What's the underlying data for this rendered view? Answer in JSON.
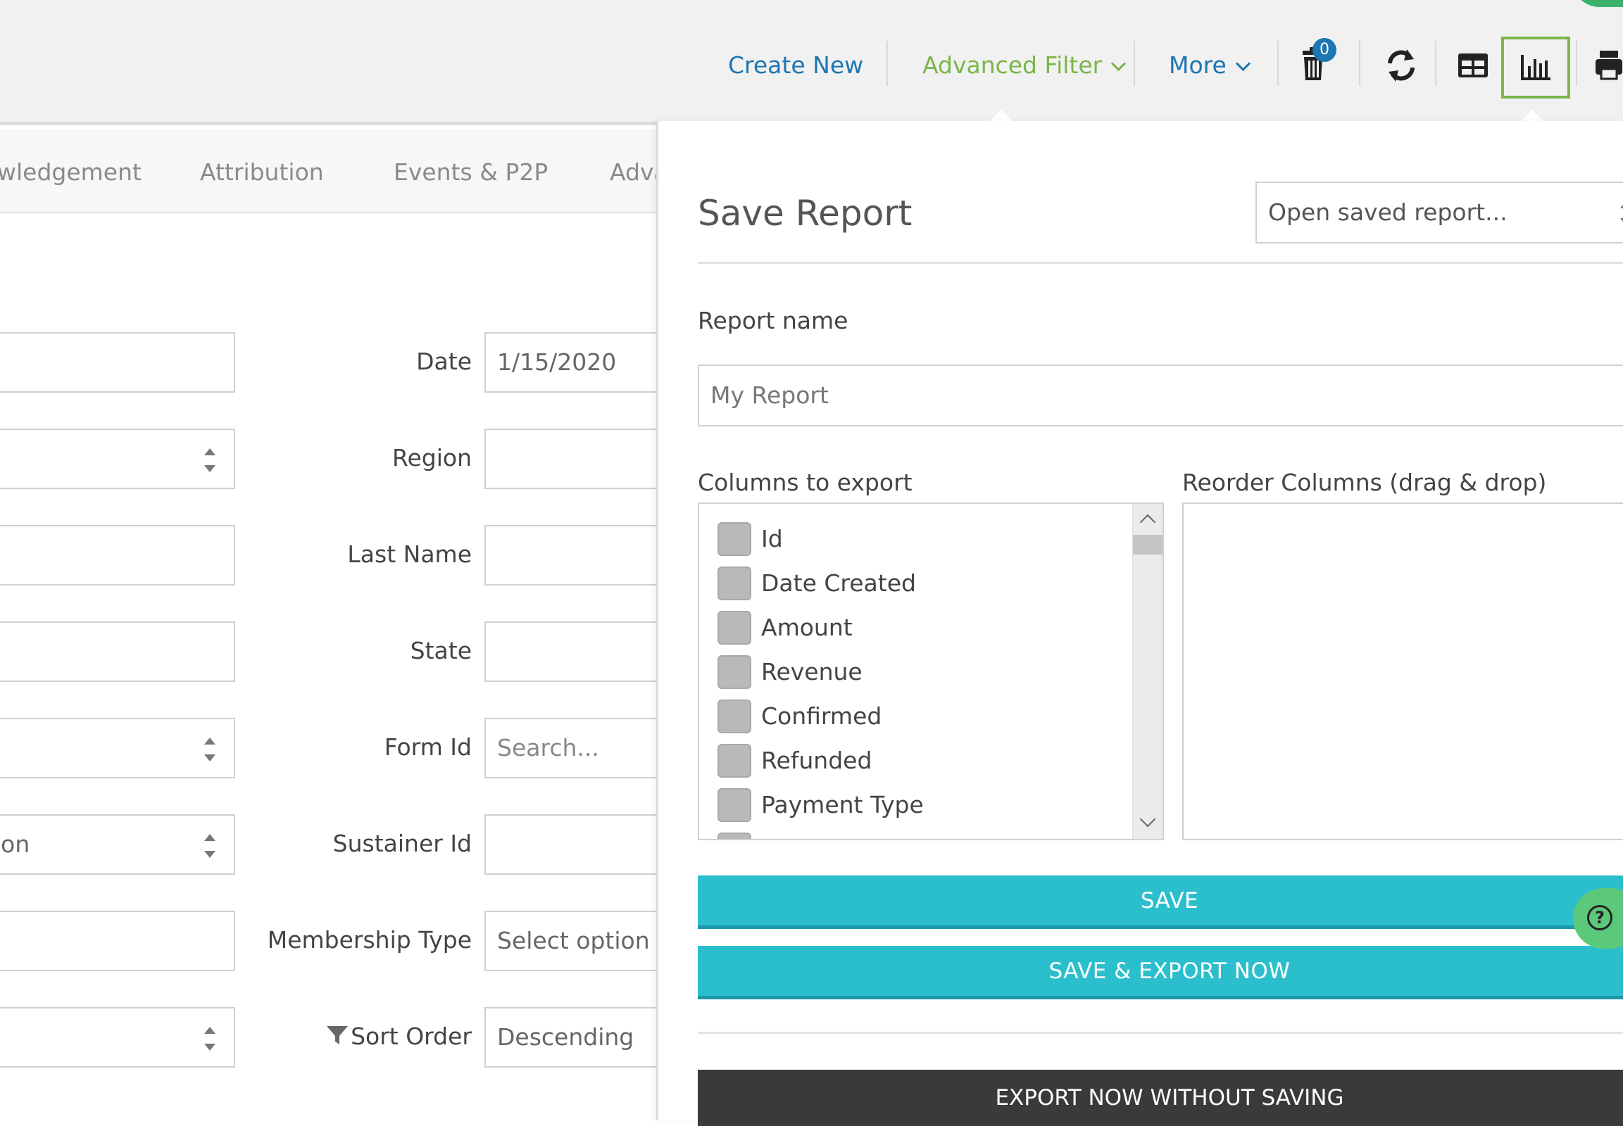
{
  "toolbar": {
    "create_new": "Create New",
    "advanced_filter": "Advanced Filter",
    "more": "More",
    "trash_count": "0",
    "icons": [
      "trash-icon",
      "refresh-icon",
      "table-icon",
      "bar-chart-icon",
      "print-icon"
    ],
    "accent_blue": "#1d76b0",
    "accent_green": "#7ab648"
  },
  "tabs": [
    "wledgement",
    "Attribution",
    "Events & P2P",
    "Adva"
  ],
  "form": {
    "fields": [
      {
        "label": "Date",
        "value": "1/15/2020",
        "kind": "text"
      },
      {
        "label": "Region",
        "value": "",
        "kind": "text"
      },
      {
        "label": "Last Name",
        "value": "",
        "kind": "text"
      },
      {
        "label": "State",
        "value": "",
        "kind": "text"
      },
      {
        "label": "Form Id",
        "value": "",
        "placeholder": "Search...",
        "kind": "text"
      },
      {
        "label": "Sustainer Id",
        "value": "",
        "kind": "text"
      },
      {
        "label": "Membership Type",
        "value": "",
        "placeholder": "Select option",
        "kind": "select"
      },
      {
        "label": "Sort Order",
        "value": "Descending",
        "kind": "select"
      }
    ],
    "left_column_value_6": "ion"
  },
  "panel": {
    "title": "Save Report",
    "open_saved_placeholder": "Open saved report...",
    "report_name_label": "Report name",
    "report_name_placeholder": "My Report",
    "columns_label": "Columns to export",
    "reorder_label": "Reorder Columns (drag & drop)",
    "columns": [
      "Id",
      "Date Created",
      "Amount",
      "Revenue",
      "Confirmed",
      "Refunded",
      "Payment Type"
    ],
    "save_button": "SAVE",
    "save_export_button": "SAVE & EXPORT NOW",
    "export_without_saving_button": "EXPORT NOW WITHOUT SAVING",
    "button_color": "#2bbfcd"
  },
  "help": {
    "icon": "question-circle-icon",
    "symbol": "?"
  }
}
